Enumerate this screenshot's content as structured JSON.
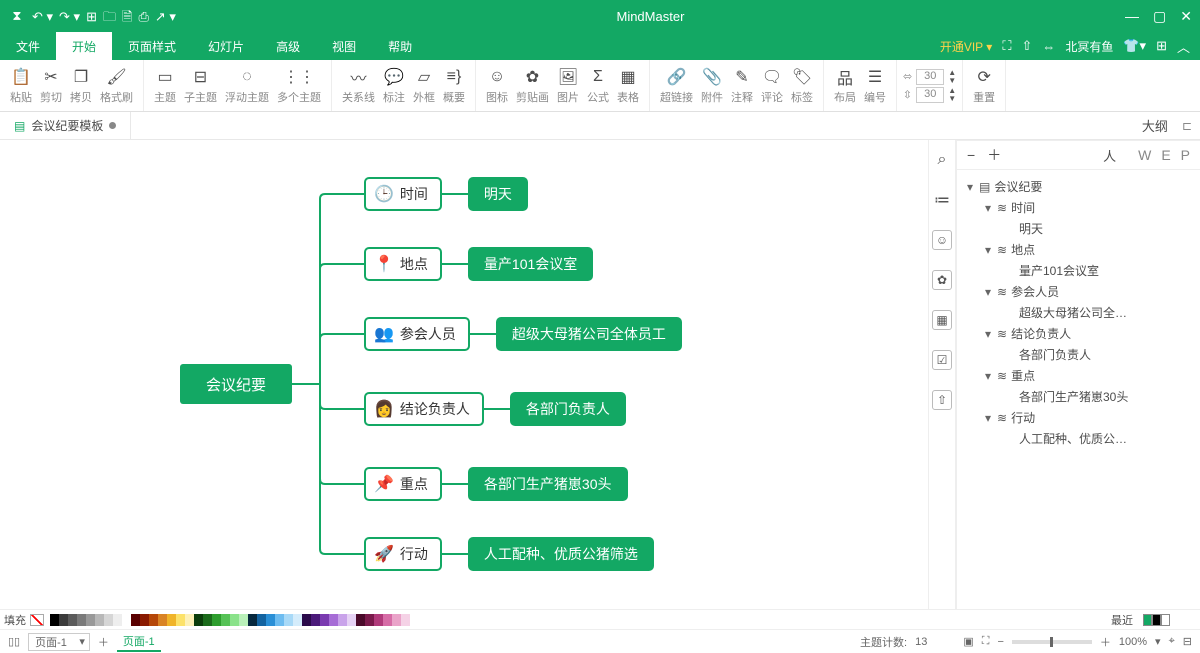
{
  "app_title": "MindMaster",
  "user_name": "北冥有鱼",
  "vip_text": "开通VIP ▾",
  "menu": [
    "文件",
    "开始",
    "页面样式",
    "幻灯片",
    "高级",
    "视图",
    "帮助"
  ],
  "menu_active_idx": 1,
  "ribbon": {
    "paste": "粘贴",
    "cut": "剪切",
    "copy": "拷贝",
    "format": "格式刷",
    "topic": "主题",
    "subtopic": "子主题",
    "float": "浮动主题",
    "multi": "多个主题",
    "relation": "关系线",
    "callout": "标注",
    "frame": "外框",
    "summary": "概要",
    "icon": "图标",
    "clipart": "剪贴画",
    "picture": "图片",
    "formula": "公式",
    "table": "表格",
    "hyperlink": "超链接",
    "attach": "附件",
    "note": "注释",
    "comment": "评论",
    "tag": "标签",
    "layout": "布局",
    "number": "编号",
    "width_val": "30",
    "height_val": "30",
    "reset": "重置"
  },
  "doc_tab": "会议纪要模板",
  "mindmap": {
    "root": "会议纪要",
    "branches": [
      {
        "icon": "🕒",
        "label": "时间",
        "sub": "明天"
      },
      {
        "icon": "📍",
        "label": "地点",
        "sub": "量产101会议室"
      },
      {
        "icon": "👥",
        "label": "参会人员",
        "sub": "超级大母猪公司全体员工"
      },
      {
        "icon": "👩",
        "label": "结论负责人",
        "sub": "各部门负责人"
      },
      {
        "icon": "📌",
        "label": "重点",
        "sub": "各部门生产猪崽30头"
      },
      {
        "icon": "🚀",
        "label": "行动",
        "sub": "人工配种、优质公猪筛选"
      }
    ]
  },
  "outline": {
    "title": "大纲",
    "letters": [
      "W",
      "E",
      "P"
    ],
    "tree": [
      {
        "indent": 0,
        "caret": "▾",
        "icon": "▤",
        "text": "会议纪要"
      },
      {
        "indent": 1,
        "caret": "▾",
        "icon": "≋",
        "text": "时间"
      },
      {
        "indent": 2,
        "caret": "",
        "icon": "",
        "text": "明天"
      },
      {
        "indent": 1,
        "caret": "▾",
        "icon": "≋",
        "text": "地点"
      },
      {
        "indent": 2,
        "caret": "",
        "icon": "",
        "text": "量产101会议室"
      },
      {
        "indent": 1,
        "caret": "▾",
        "icon": "≋",
        "text": "参会人员"
      },
      {
        "indent": 2,
        "caret": "",
        "icon": "",
        "text": "超级大母猪公司全…"
      },
      {
        "indent": 1,
        "caret": "▾",
        "icon": "≋",
        "text": "结论负责人"
      },
      {
        "indent": 2,
        "caret": "",
        "icon": "",
        "text": "各部门负责人"
      },
      {
        "indent": 1,
        "caret": "▾",
        "icon": "≋",
        "text": "重点"
      },
      {
        "indent": 2,
        "caret": "",
        "icon": "",
        "text": "各部门生产猪崽30头"
      },
      {
        "indent": 1,
        "caret": "▾",
        "icon": "≋",
        "text": "行动"
      },
      {
        "indent": 2,
        "caret": "",
        "icon": "",
        "text": "人工配种、优质公…"
      }
    ]
  },
  "fill_label": "填充",
  "recent_label": "最近",
  "status": {
    "page_select": "页面-1",
    "page_tab": "页面-1",
    "topic_count_label": "主题计数:",
    "topic_count": "13",
    "zoom": "100%"
  },
  "swatch_colors": [
    "#000",
    "#3b3b3b",
    "#5b5b5b",
    "#7a7a7a",
    "#999",
    "#b8b8b8",
    "#d6d6d6",
    "#eee",
    "#fff",
    "#5a0000",
    "#8a1a00",
    "#b54708",
    "#d98324",
    "#f0b429",
    "#fce26a",
    "#fdf1b8",
    "#0b3d0b",
    "#1b6b1b",
    "#2e9e2e",
    "#56c256",
    "#8ae28a",
    "#b9f0b9",
    "#06283d",
    "#1363a0",
    "#2a8fd6",
    "#6dbcf0",
    "#a8d9f7",
    "#d4ecfb",
    "#2a0a4a",
    "#4b1a7a",
    "#7a3ab0",
    "#a66cd6",
    "#c9a3ea",
    "#e6d2f5",
    "#4a0a2a",
    "#7a1a4b",
    "#b03a7a",
    "#d66ca6",
    "#eaa3c9",
    "#f5d2e6"
  ],
  "recent_swatches": [
    "#13a864",
    "#000",
    "#fff"
  ]
}
